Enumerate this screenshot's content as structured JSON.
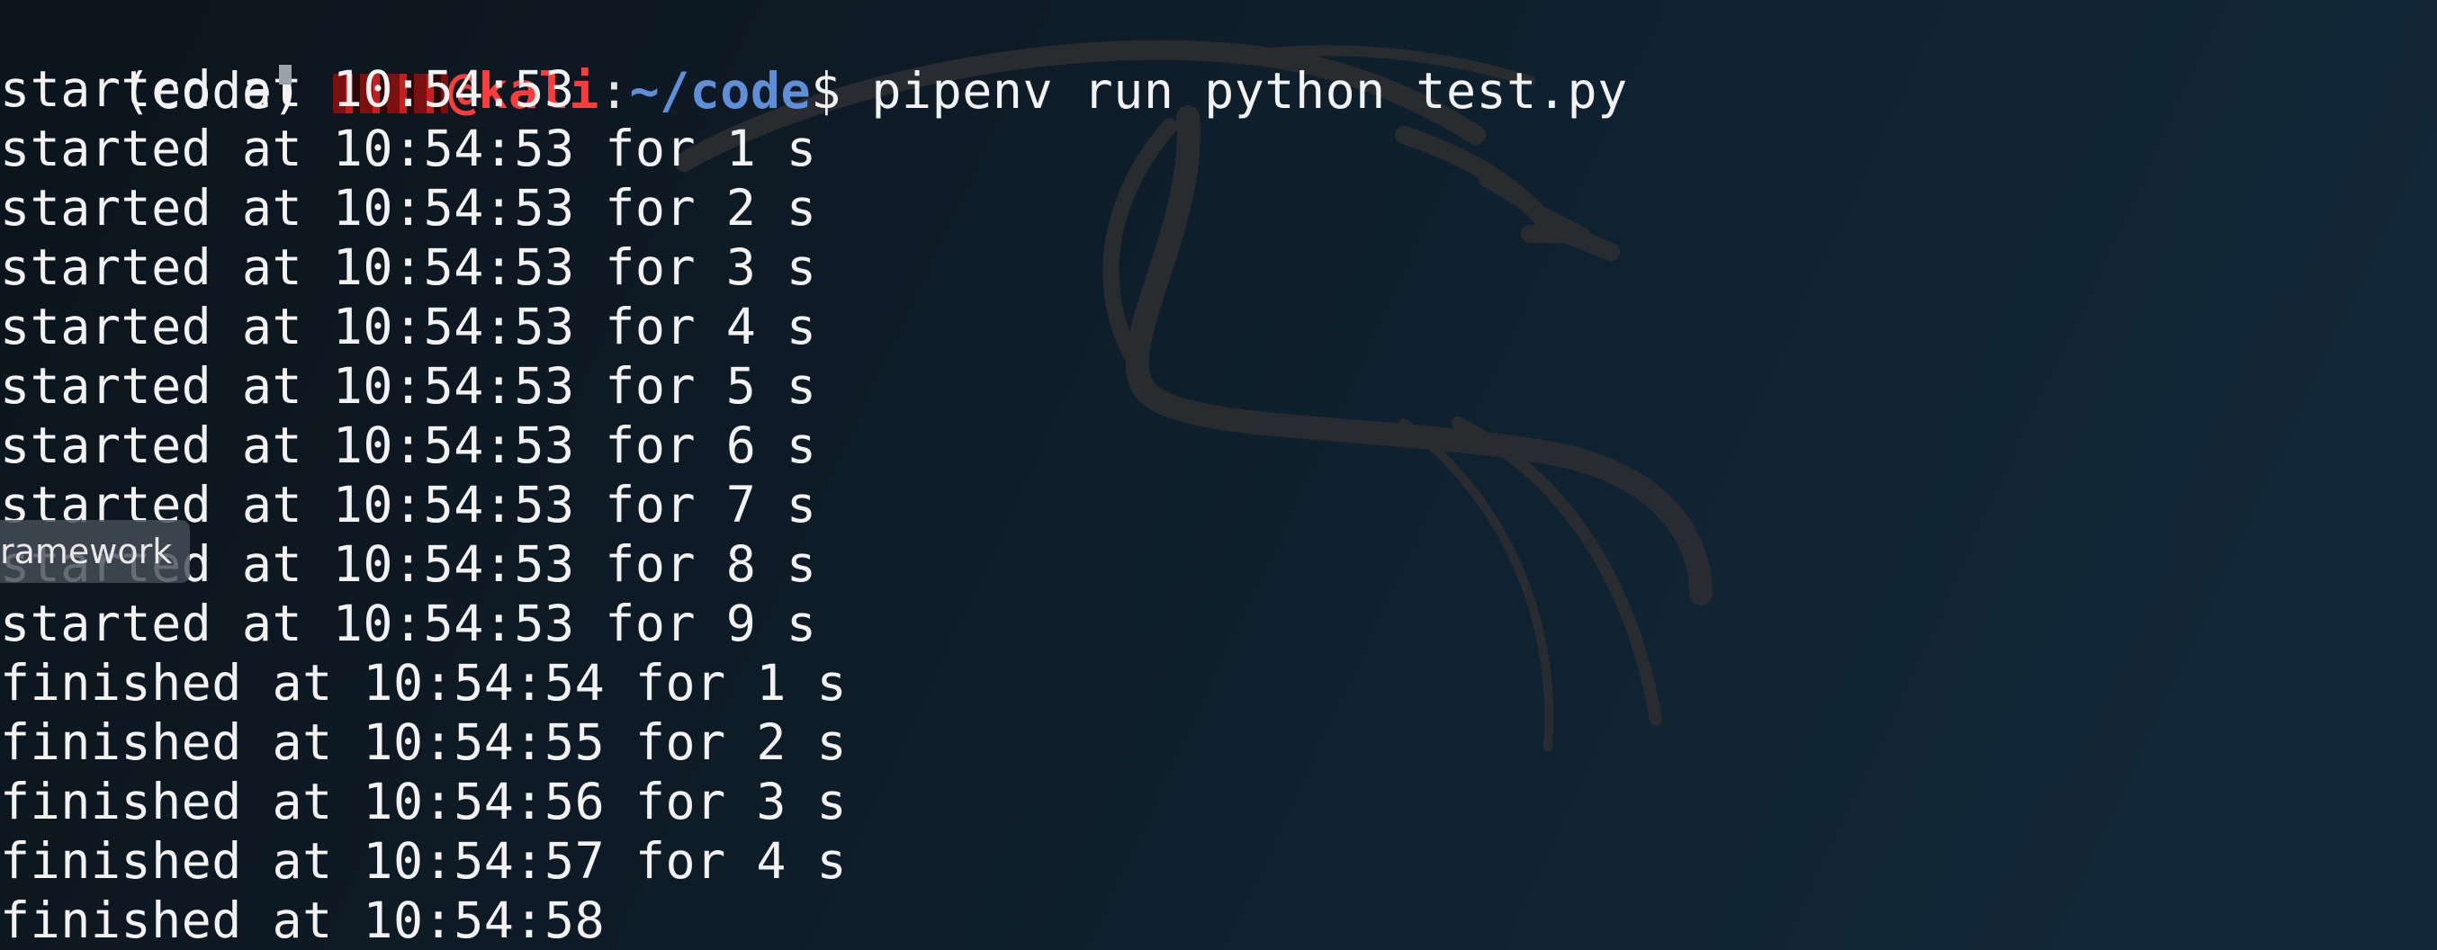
{
  "prompt": {
    "env": "(code) ",
    "host": "@kali",
    "colon": ":",
    "path": "~/code",
    "symbol": "$ ",
    "command": "pipenv run python test.py"
  },
  "output_lines": [
    "started at 10:54:53",
    "started at 10:54:53 for 1 s",
    "started at 10:54:53 for 2 s",
    "started at 10:54:53 for 3 s",
    "started at 10:54:53 for 4 s",
    "started at 10:54:53 for 5 s",
    "started at 10:54:53 for 6 s",
    "started at 10:54:53 for 7 s",
    "started at 10:54:53 for 8 s",
    "started at 10:54:53 for 9 s",
    "finished at 10:54:54 for 1 s",
    "finished at 10:54:55 for 2 s",
    "finished at 10:54:56 for 3 s",
    "finished at 10:54:57 for 4 s",
    "finished at 10:54:58"
  ],
  "tooltip": {
    "text": "ramework"
  },
  "colors": {
    "background": "#0e1b26",
    "text": "#f2f2f2",
    "user_host": "#ff3b3b",
    "path": "#5f8fd8"
  }
}
